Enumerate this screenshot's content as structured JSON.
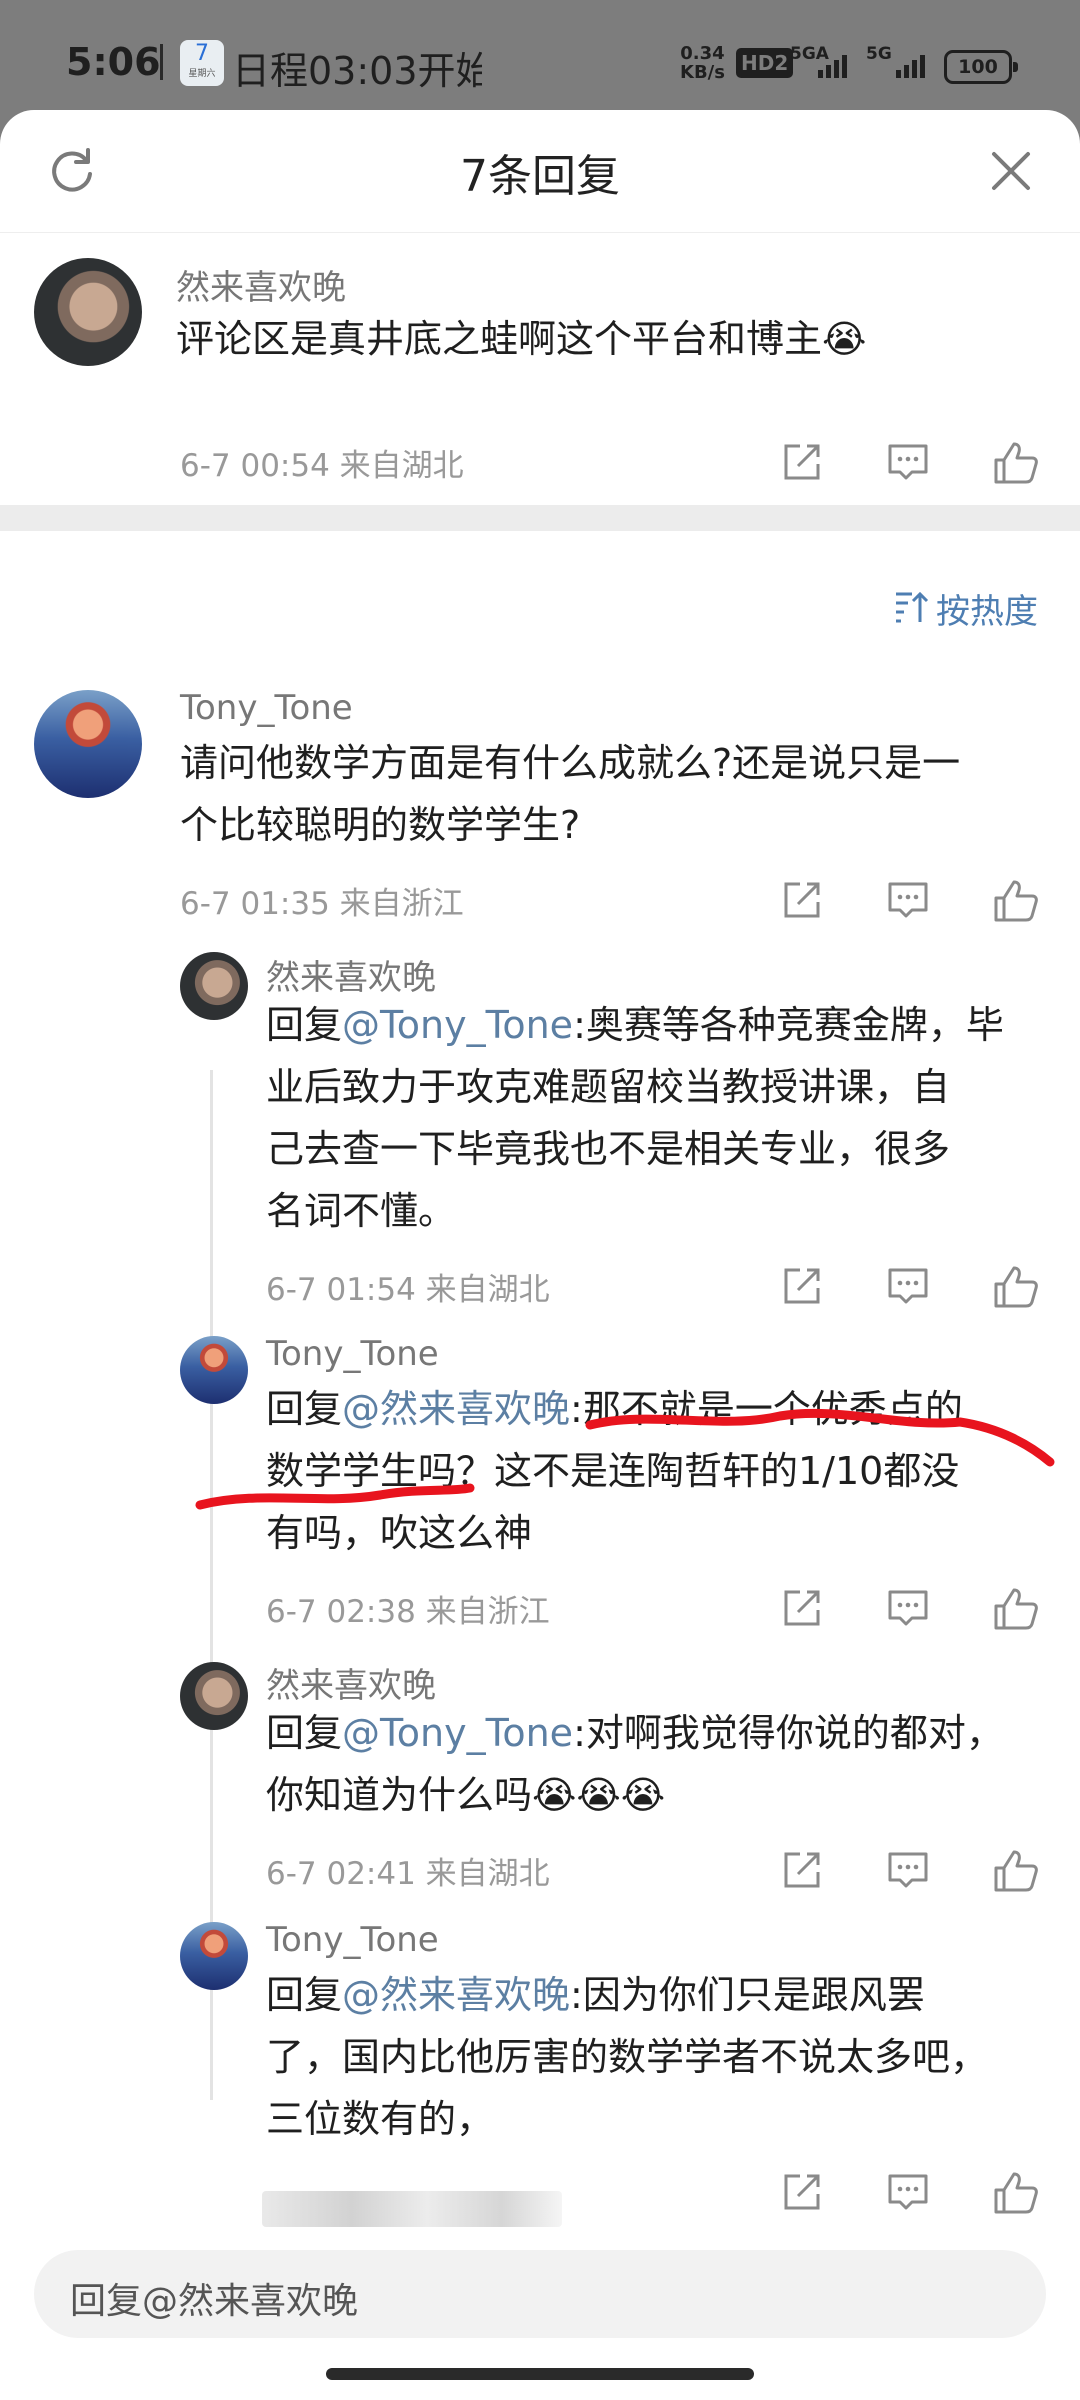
{
  "status_bar": {
    "time": "5:06",
    "calendar_day": "7",
    "calendar_sub": "星期六",
    "notification": "日程03:03开始",
    "net_speed_value": "0.34",
    "net_speed_unit": "KB/s",
    "hd_badge": "HD2",
    "signal1": "5GA",
    "signal2": "5G",
    "battery": "100"
  },
  "header": {
    "title": "7条回复",
    "refresh_icon": "refresh-icon",
    "close_icon": "close-icon"
  },
  "root_comment": {
    "username": "然来喜欢晚",
    "text": "评论区是真井底之蛙啊这个平台和博主😭",
    "meta": "6-7 00:54  来自湖北"
  },
  "sort_label": "按热度",
  "replies": [
    {
      "username": "Tony_Tone",
      "line1": "请问他数学方面是有什么成就么?还是说只是一",
      "line2": "个比较聪明的数学学生?",
      "meta": "6-7 01:35  来自浙江"
    },
    {
      "username": "然来喜欢晚",
      "prefix": "回复",
      "at": "@Tony_Tone",
      "line1_rest": ":奥赛等各种竞赛金牌，毕",
      "line2": "业后致力于攻克难题留校当教授讲课，自",
      "line3": "己去查一下毕竟我也不是相关专业，很多",
      "line4": "名词不懂。",
      "meta": "6-7 01:54  来自湖北"
    },
    {
      "username": "Tony_Tone",
      "prefix": "回复",
      "at": "@然来喜欢晚",
      "line1_rest": ":那不就是一个优秀点的",
      "line2": "数学学生吗？这不是连陶哲轩的1/10都没",
      "line3": "有吗，吹这么神",
      "meta": "6-7 02:38  来自浙江"
    },
    {
      "username": "然来喜欢晚",
      "prefix": "回复",
      "at": "@Tony_Tone",
      "line1_rest": ":对啊我觉得你说的都对，",
      "line2": "你知道为什么吗😭😭😭",
      "meta": "6-7 02:41  来自湖北"
    },
    {
      "username": "Tony_Tone",
      "prefix": "回复",
      "at": "@然来喜欢晚",
      "line1_rest": ":因为你们只是跟风罢",
      "line2": "了，国内比他厉害的数学学者不说太多吧，",
      "line3": "三位数有的，"
    }
  ],
  "reply_input": {
    "placeholder": "回复@然来喜欢晚"
  },
  "action_icons": [
    "share-icon",
    "comment-icon",
    "like-icon"
  ],
  "colors": {
    "mention": "#5c7fa3",
    "sort": "#4e7eb2",
    "annotation": "#e8141e"
  }
}
